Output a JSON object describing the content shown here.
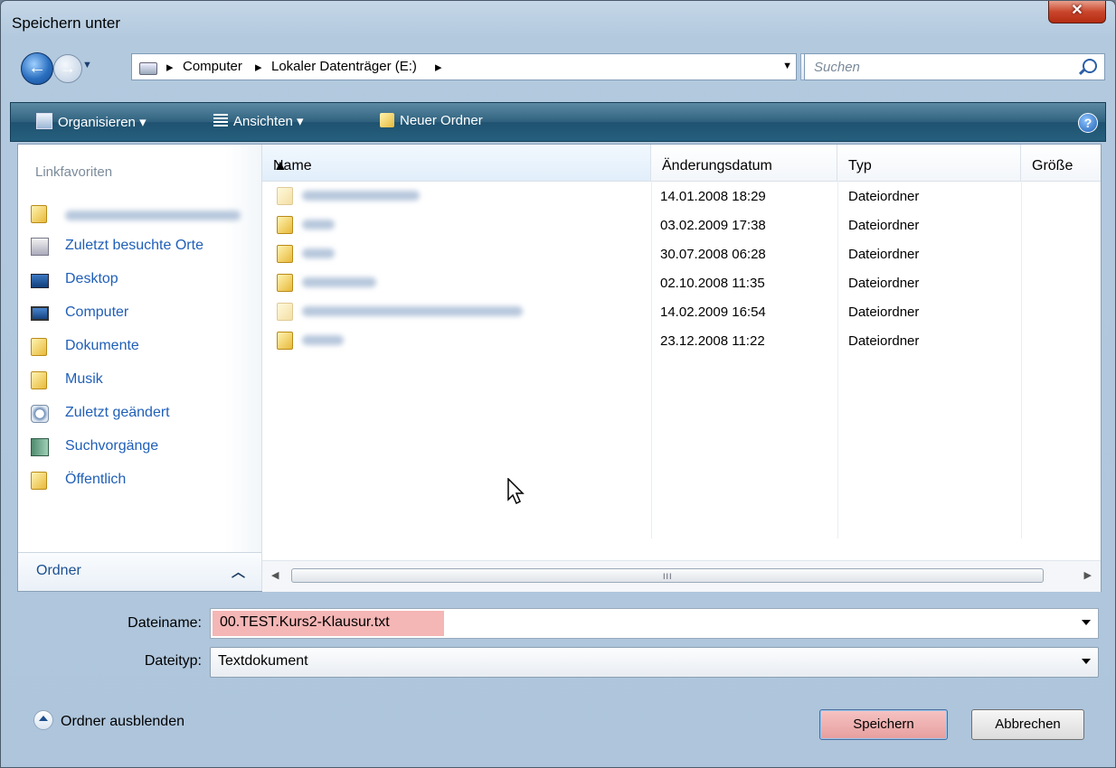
{
  "window": {
    "title": "Speichern unter",
    "close_glyph": "✕"
  },
  "address": {
    "crumbs": [
      "Computer",
      "Lokaler Datenträger (E:)"
    ],
    "search_placeholder": "Suchen"
  },
  "toolbar": {
    "organize": "Organisieren",
    "views": "Ansichten",
    "new_folder": "Neuer Ordner",
    "help": "?"
  },
  "sidebar": {
    "title": "Linkfavoriten",
    "items": [
      {
        "label": "",
        "icon": "folder-icon",
        "blurred": true
      },
      {
        "label": "Zuletzt besuchte Orte",
        "icon": "recent-places-icon"
      },
      {
        "label": "Desktop",
        "icon": "desktop-icon"
      },
      {
        "label": "Computer",
        "icon": "computer-icon"
      },
      {
        "label": "Dokumente",
        "icon": "folder-icon"
      },
      {
        "label": "Musik",
        "icon": "folder-icon"
      },
      {
        "label": "Zuletzt geändert",
        "icon": "recently-changed-icon"
      },
      {
        "label": "Suchvorgänge",
        "icon": "searches-icon"
      },
      {
        "label": "Öffentlich",
        "icon": "folder-icon"
      }
    ],
    "folders_label": "Ordner"
  },
  "filelist": {
    "columns": [
      "Name",
      "Änderungsdatum",
      "Typ",
      "Größe"
    ],
    "rows": [
      {
        "name": "",
        "date": "14.01.2008 18:29",
        "type": "Dateiordner",
        "blurred": true
      },
      {
        "name": "",
        "date": "03.02.2009 17:38",
        "type": "Dateiordner",
        "blurred": true
      },
      {
        "name": "",
        "date": "30.07.2008 06:28",
        "type": "Dateiordner",
        "blurred": true
      },
      {
        "name": "",
        "date": "02.10.2008 11:35",
        "type": "Dateiordner",
        "blurred": true
      },
      {
        "name": "",
        "date": "14.02.2009 16:54",
        "type": "Dateiordner",
        "blurred": true
      },
      {
        "name": "",
        "date": "23.12.2008 11:22",
        "type": "Dateiordner",
        "blurred": true
      }
    ],
    "scroll_grip": "III"
  },
  "form": {
    "filename_label": "Dateiname:",
    "filename_value": "00.TEST.Kurs2-Klausur.txt",
    "filetype_label": "Dateityp:",
    "filetype_value": "Textdokument"
  },
  "footer": {
    "hide_folders": "Ordner ausblenden",
    "save": "Speichern",
    "cancel": "Abbrechen"
  },
  "colors": {
    "toolbar_bg": "#2f617e",
    "link_blue": "#1f5fb8",
    "selection_red": "#f5b6b6",
    "close_red": "#c9462c"
  }
}
